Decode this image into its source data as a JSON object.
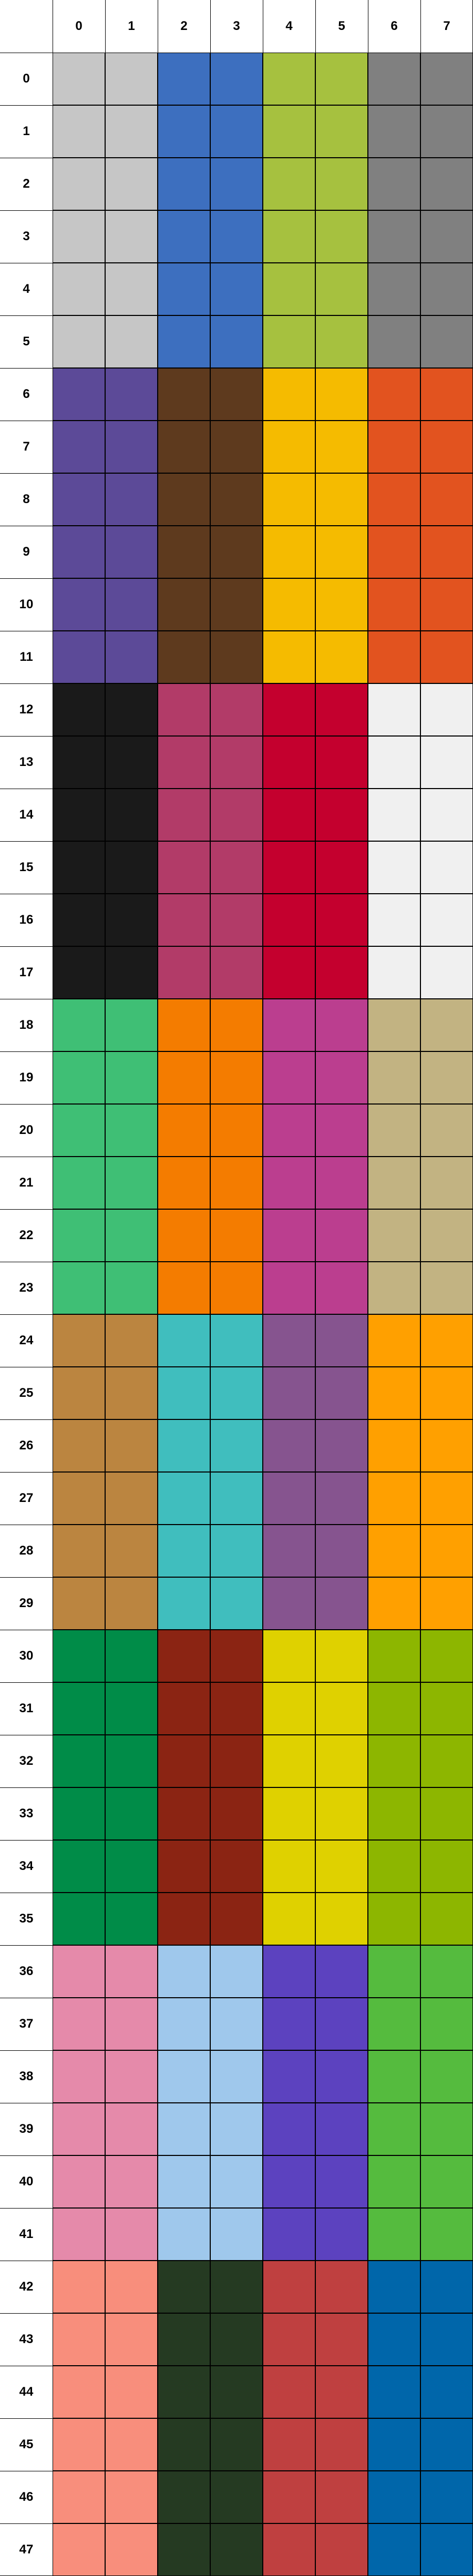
{
  "columns": [
    "0",
    "1",
    "2",
    "3",
    "4",
    "5",
    "6",
    "7"
  ],
  "rows": [
    "0",
    "1",
    "2",
    "3",
    "4",
    "5",
    "6",
    "7",
    "8",
    "9",
    "10",
    "11",
    "12",
    "13",
    "14",
    "15",
    "16",
    "17",
    "18",
    "19",
    "20",
    "21",
    "22",
    "23",
    "24",
    "25",
    "26",
    "27",
    "28",
    "29",
    "30",
    "31",
    "32",
    "33",
    "34",
    "35",
    "36",
    "37",
    "38",
    "39",
    "40",
    "41",
    "42",
    "43",
    "44",
    "45",
    "46",
    "47"
  ],
  "block_rows": 6,
  "block_cols": 2,
  "blocks": [
    [
      "#c6c6c6",
      "#3d6fbf",
      "#a6c13f",
      "#808080"
    ],
    [
      "#5c4a98",
      "#5e3a1e",
      "#f5bb00",
      "#e2531f"
    ],
    [
      "#1a1a1a",
      "#b23b68",
      "#c4002e",
      "#f0f0f0"
    ],
    [
      "#3fbf75",
      "#f47c00",
      "#bb3e8f",
      "#c2b382"
    ],
    [
      "#bb8540",
      "#40bebe",
      "#86548f",
      "#ffa000"
    ],
    [
      "#008c48",
      "#8b2413",
      "#dfd100",
      "#8db600"
    ],
    [
      "#e58aaa",
      "#9fc8ec",
      "#5c42bf",
      "#55bb3e"
    ],
    [
      "#f88e7c",
      "#253a22",
      "#bf4040",
      "#0066aa"
    ]
  ]
}
